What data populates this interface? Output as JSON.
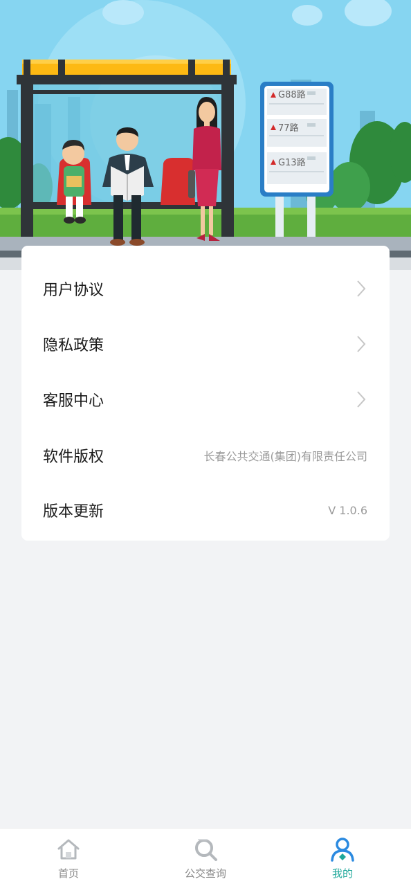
{
  "menu": {
    "items": [
      {
        "label": "用户协议",
        "value": ""
      },
      {
        "label": "隐私政策",
        "value": ""
      },
      {
        "label": "客服中心",
        "value": ""
      },
      {
        "label": "软件版权",
        "value": "长春公共交通(集团)有限责任公司"
      },
      {
        "label": "版本更新",
        "value": "V 1.0.6"
      }
    ]
  },
  "hero": {
    "route_signs": [
      "G88路",
      "77路",
      "G13路"
    ]
  },
  "tabbar": {
    "tabs": [
      {
        "label": "首页",
        "icon": "home-icon",
        "active": false
      },
      {
        "label": "公交查询",
        "icon": "search-icon",
        "active": false
      },
      {
        "label": "我的",
        "icon": "user-icon",
        "active": true
      }
    ]
  },
  "colors": {
    "accent": "#1fa89a",
    "sky": "#7fd0ef",
    "shelter_roof": "#fdb913",
    "page_bg": "#f2f3f5"
  }
}
